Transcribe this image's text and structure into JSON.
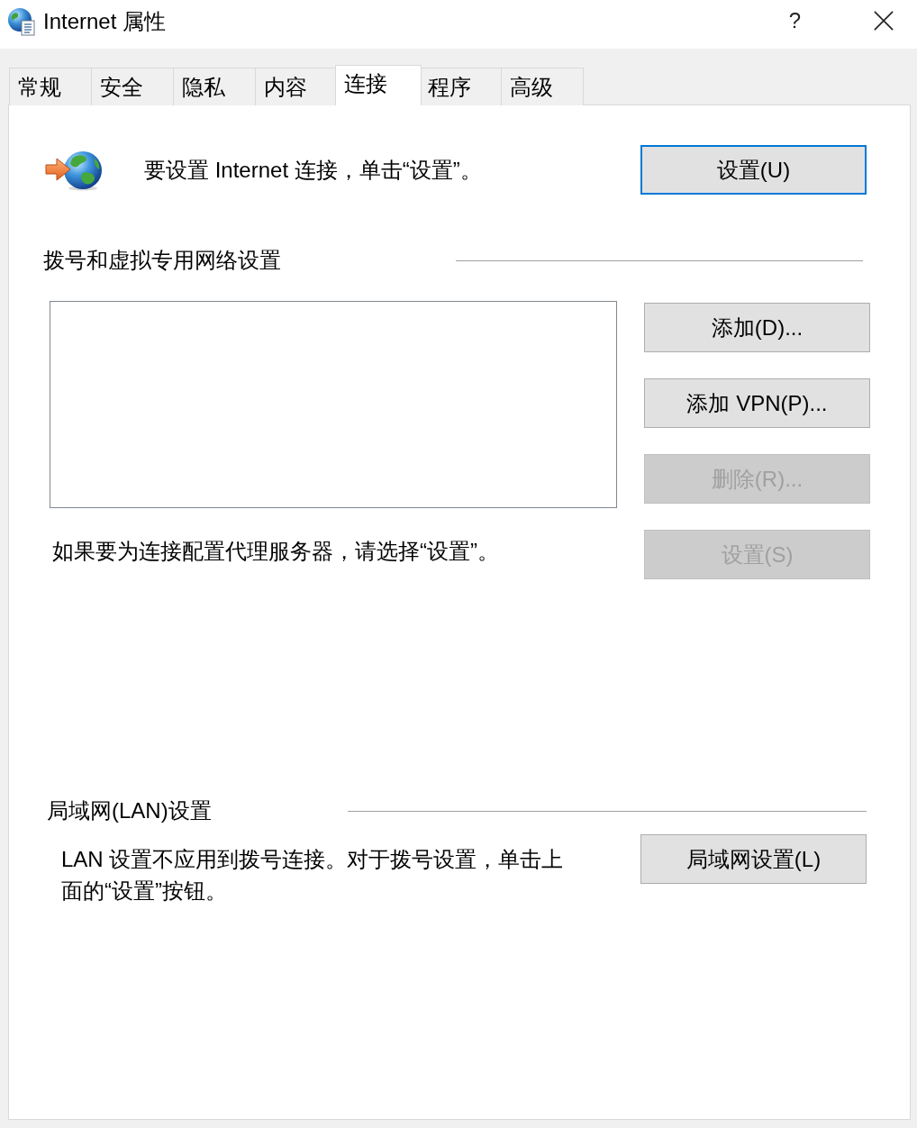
{
  "window": {
    "title": "Internet 属性",
    "help_label": "?"
  },
  "tabs": [
    {
      "label": "常规",
      "selected": false
    },
    {
      "label": "安全",
      "selected": false
    },
    {
      "label": "隐私",
      "selected": false
    },
    {
      "label": "内容",
      "selected": false
    },
    {
      "label": "连接",
      "selected": true
    },
    {
      "label": "程序",
      "selected": false
    },
    {
      "label": "高级",
      "selected": false
    }
  ],
  "connection": {
    "text": "要设置 Internet 连接，单击“设置”。",
    "button": {
      "label": "设置(U)",
      "focused": true
    }
  },
  "dialup": {
    "heading": "拨号和虚拟专用网络设置",
    "buttons": [
      {
        "label": "添加(D)...",
        "disabled": false
      },
      {
        "label": "添加 VPN(P)...",
        "disabled": false
      },
      {
        "label": "删除(R)...",
        "disabled": true
      },
      {
        "label": "设置(S)",
        "disabled": true
      }
    ],
    "proxy_text": "如果要为连接配置代理服务器，请选择“设置”。"
  },
  "lan": {
    "heading": "局域网(LAN)设置",
    "text": "LAN 设置不应用到拨号连接。对于拨号设置，单击上面的“设置”按钮。",
    "button": {
      "label": "局域网设置(L)"
    }
  }
}
